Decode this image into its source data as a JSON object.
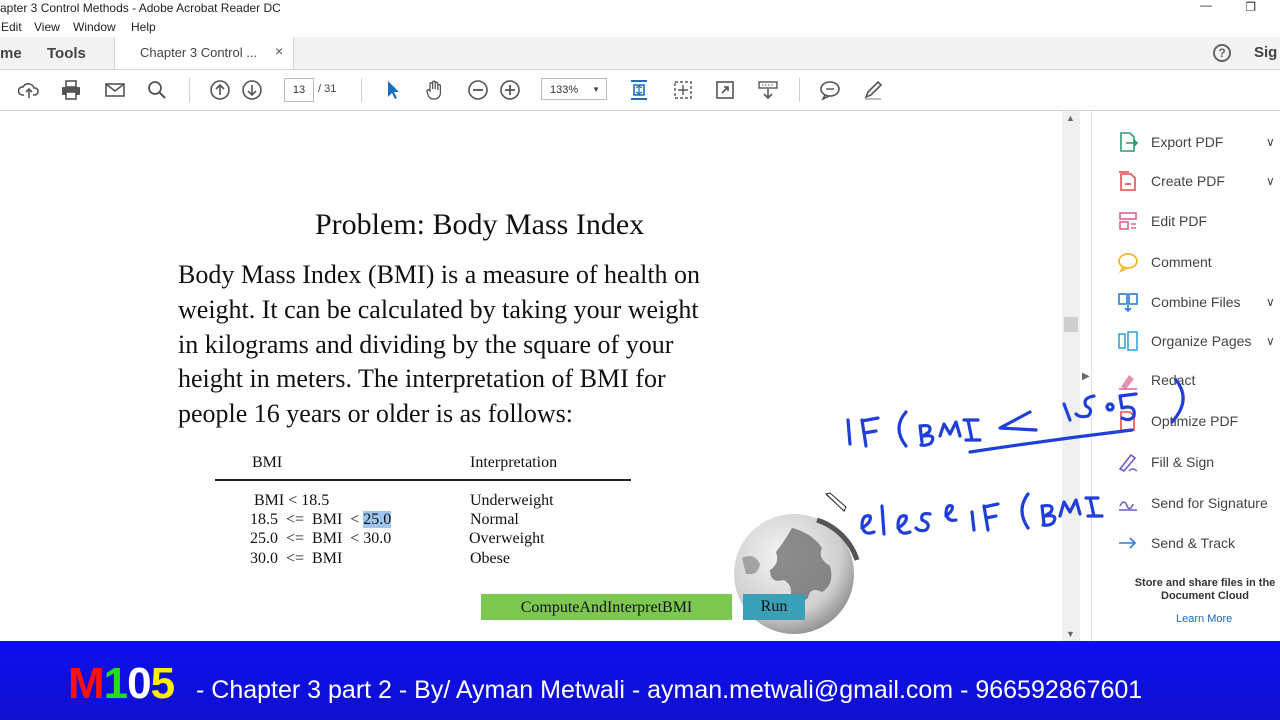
{
  "window": {
    "title": "apter 3 Control Methods - Adobe Acrobat Reader DC"
  },
  "menu": [
    "Edit",
    "View",
    "Window",
    "Help"
  ],
  "tabs": {
    "home": "me",
    "tools": "Tools",
    "document": "Chapter 3 Control ...",
    "close": "×",
    "sign_in": "Sig"
  },
  "toolbar": {
    "page_current": "13",
    "page_total": "/ 31",
    "zoom": "133%"
  },
  "document": {
    "heading": "Problem: Body Mass Index",
    "paragraph": [
      "Body Mass Index (BMI) is a measure of health on",
      "weight. It can be calculated by taking your weight",
      "in kilograms and dividing by the square of your",
      "height in meters. The interpretation of BMI for",
      "people 16 years or older is as follows:"
    ],
    "table": {
      "headers": [
        "BMI",
        "Interpretation"
      ],
      "rows": [
        {
          "bmi": "BMI < 18.5",
          "interp": "Underweight"
        },
        {
          "bmi_prefix": "18.5  <=  BMI  < ",
          "bmi_highlight": "25.0",
          "interp": "Normal"
        },
        {
          "bmi": "25.0  <=  BMI  < 30.0",
          "interp": "Overweight"
        },
        {
          "bmi": "30.0  <=  BMI",
          "interp": "Obese"
        }
      ]
    },
    "buttons": {
      "compute": "ComputeAndInterpretBMI",
      "run": "Run"
    }
  },
  "right_pane": {
    "items": [
      {
        "label": "Export PDF",
        "icon": "export-pdf-icon",
        "color": "#2d9c6e",
        "chevron": true
      },
      {
        "label": "Create PDF",
        "icon": "create-pdf-icon",
        "color": "#e0524f",
        "chevron": true
      },
      {
        "label": "Edit PDF",
        "icon": "edit-pdf-icon",
        "color": "#e0608f",
        "chevron": false
      },
      {
        "label": "Comment",
        "icon": "comment-icon",
        "color": "#f2b626",
        "chevron": false
      },
      {
        "label": "Combine Files",
        "icon": "combine-files-icon",
        "color": "#2b7fd4",
        "chevron": true
      },
      {
        "label": "Organize Pages",
        "icon": "organize-pages-icon",
        "color": "#3aa3d9",
        "chevron": true
      },
      {
        "label": "Redact",
        "icon": "redact-icon",
        "color": "#e0608f",
        "chevron": false
      },
      {
        "label": "Optimize PDF",
        "icon": "optimize-pdf-icon",
        "color": "#e0524f",
        "chevron": false
      },
      {
        "label": "Fill & Sign",
        "icon": "fill-sign-icon",
        "color": "#6b5fc7",
        "chevron": false
      },
      {
        "label": "Send for Signature",
        "icon": "send-signature-icon",
        "color": "#6b5fc7",
        "chevron": false
      },
      {
        "label": "Send & Track",
        "icon": "send-track-icon",
        "color": "#2b7fd4",
        "chevron": false
      }
    ],
    "store_text": "Store and share files in the Document Cloud",
    "learn_more": "Learn More"
  },
  "banner": {
    "m": "M",
    "one": "1",
    "zero": "0",
    "five": "5",
    "text": "- Chapter 3 part 2 - By/ Ayman Metwali - ayman.metwali@gmail.com - 966592867601",
    "colors": {
      "m": "#ff1010",
      "one": "#22dd22",
      "zero": "#ffffff",
      "five": "#ffee00",
      "background": "#1010e0"
    }
  }
}
